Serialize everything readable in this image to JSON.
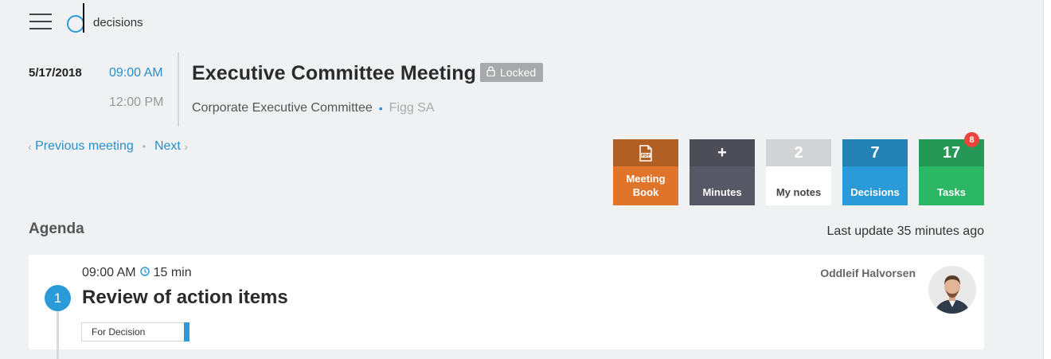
{
  "app": {
    "logo_text": "decisions"
  },
  "meeting": {
    "date": "5/17/2018",
    "start_time": "09:00 AM",
    "end_time": "12:00 PM",
    "title": "Executive Committee Meeting",
    "status": "Locked",
    "committee": "Corporate Executive Committee",
    "company": "Figg SA"
  },
  "nav": {
    "previous": "Previous meeting",
    "next": "Next"
  },
  "tiles": {
    "meeting_book": {
      "label_line1": "Meeting",
      "label_line2": "Book",
      "icon": "pdf-icon"
    },
    "minutes": {
      "top": "+",
      "label": "Minutes"
    },
    "my_notes": {
      "top": "2",
      "label": "My notes"
    },
    "decisions": {
      "top": "7",
      "label": "Decisions"
    },
    "tasks": {
      "top": "17",
      "label": "Tasks",
      "badge": "8"
    }
  },
  "agenda": {
    "label": "Agenda",
    "last_update": "Last update 35 minutes ago",
    "items": [
      {
        "number": "1",
        "time": "09:00 AM",
        "duration": "15 min",
        "title": "Review of action items",
        "tag": "For Decision",
        "presenter": "Oddleif Halvorsen"
      }
    ]
  },
  "colors": {
    "accent": "#2a9bd8",
    "book": "#e0742a",
    "minutes": "#575865",
    "decisions": "#2a9bd8",
    "tasks": "#2cb765",
    "badge": "#e9453c"
  }
}
